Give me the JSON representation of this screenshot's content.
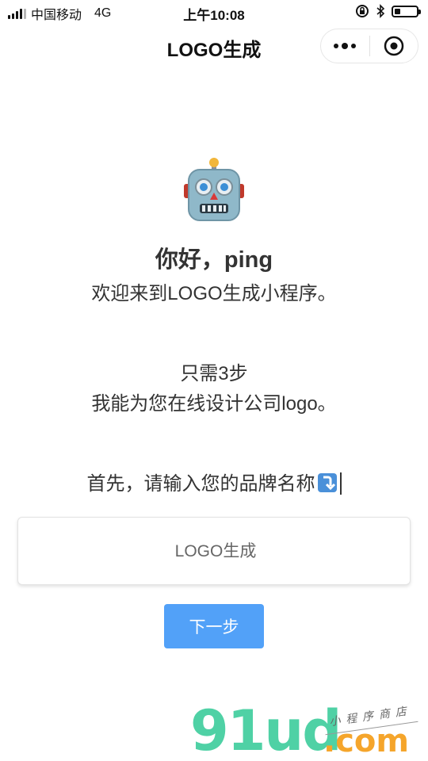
{
  "status_bar": {
    "carrier": "中国移动",
    "network": "4G",
    "time": "上午10:08",
    "battery_level": 0.25
  },
  "nav": {
    "title": "LOGO生成"
  },
  "content": {
    "robot_icon": "robot-face-emoji",
    "greeting": "你好，ping",
    "welcome": "欢迎来到LOGO生成小程序。",
    "steps": "只需3步",
    "design": "我能为您在线设计公司logo。",
    "prompt": "首先，请输入您的品牌名称",
    "prompt_icon": "arrow-down-emoji"
  },
  "form": {
    "brand_placeholder": "LOGO生成",
    "next_label": "下一步"
  },
  "watermark": {
    "brand": "91ud",
    "domain": ".com",
    "tagline": "小程序商店"
  },
  "colors": {
    "button": "#52a1f8",
    "watermark_green": "#4fd1a5",
    "watermark_orange": "#f5a52b"
  }
}
